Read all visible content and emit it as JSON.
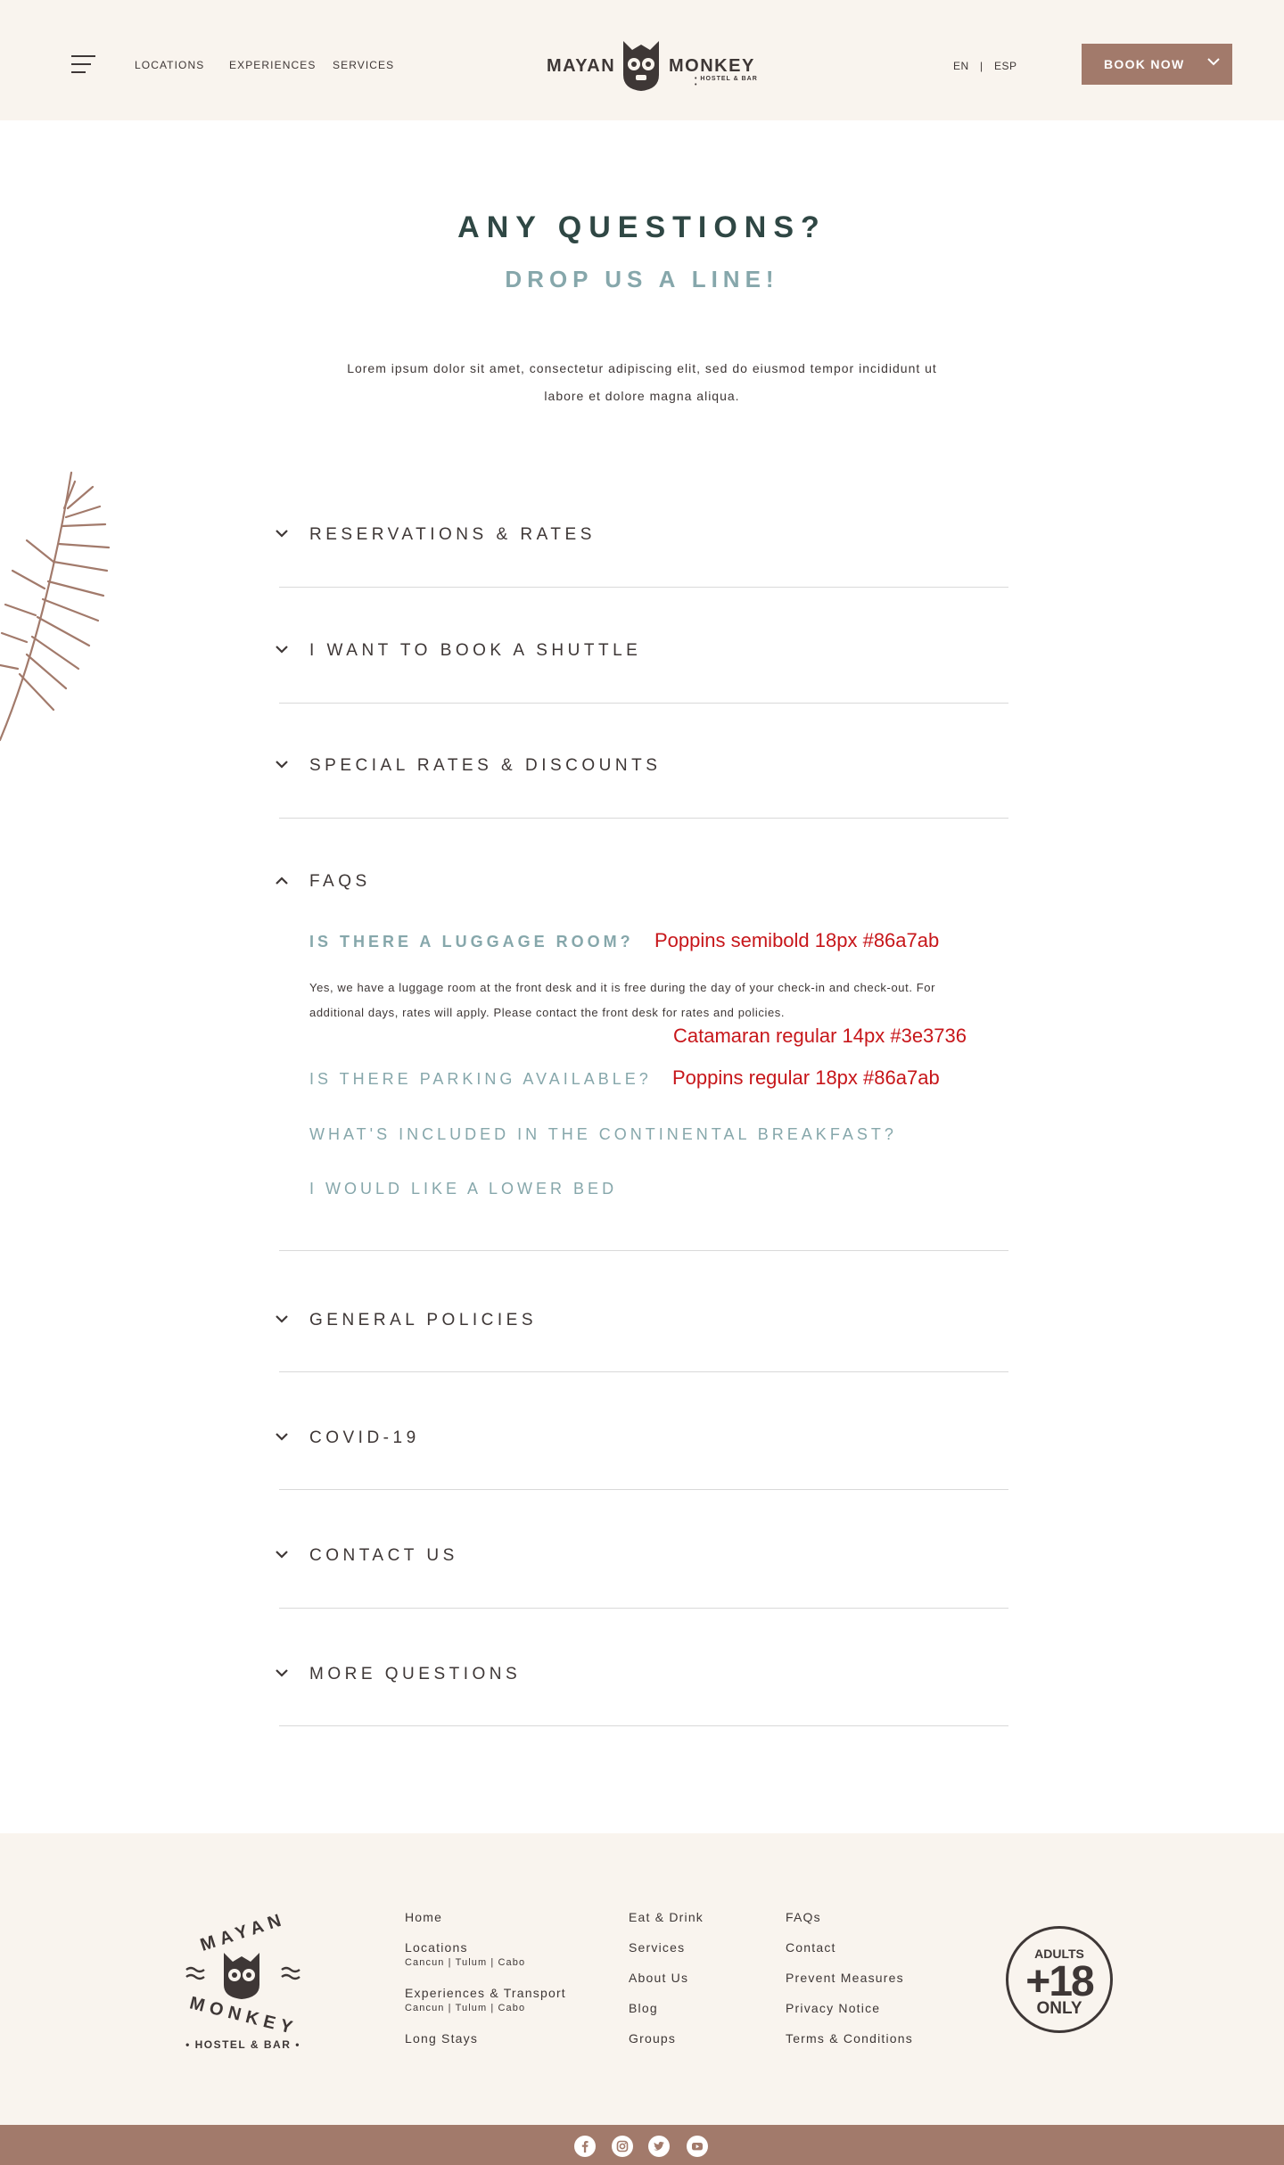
{
  "header": {
    "nav": [
      "LOCATIONS",
      "EXPERIENCES",
      "SERVICES"
    ],
    "logo_left": "MAYAN",
    "logo_right": "MONKEY",
    "logo_sub": "• HOSTEL & BAR •",
    "lang_en": "EN",
    "lang_sep": "|",
    "lang_esp": "ESP",
    "book_label": "BOOK NOW"
  },
  "hero": {
    "title": "ANY QUESTIONS?",
    "subtitle": "DROP US A LINE!",
    "intro": "Lorem ipsum dolor sit amet, consectetur adipiscing elit, sed do eiusmod tempor incididunt ut labore et dolore magna aliqua."
  },
  "accordion": {
    "sections": [
      "RESERVATIONS & RATES",
      "I WANT TO BOOK A SHUTTLE",
      "SPECIAL RATES & DISCOUNTS",
      "FAQS",
      "GENERAL POLICIES",
      "COVID-19",
      "CONTACT US",
      "MORE QUESTIONS"
    ],
    "expanded_section": "FAQS",
    "questions": [
      "IS THERE A LUGGAGE ROOM?",
      "IS THERE PARKING AVAILABLE?",
      "WHAT'S INCLUDED IN THE CONTINENTAL BREAKFAST?",
      "I WOULD LIKE A LOWER BED"
    ],
    "answer": "Yes, we have a luggage room at the front desk and it is free during the day of your check-in and check-out. For additional days, rates will apply. Please contact the front desk for rates and policies."
  },
  "annotations": {
    "q_active": "Poppins semibold 18px #86a7ab",
    "answer": "Catamaran regular 14px #3e3736",
    "q_regular": "Poppins regular 18px #86a7ab"
  },
  "footer": {
    "logo_top": "MAYAN",
    "logo_bottom": "MONKEY",
    "logo_sub": "• HOSTEL & BAR •",
    "col1": {
      "home": "Home",
      "locations": "Locations",
      "locations_sub": "Cancun | Tulum | Cabo",
      "experiences": "Experiences & Transport",
      "experiences_sub": "Cancun | Tulum | Cabo",
      "long_stays": "Long Stays"
    },
    "col2": [
      "Eat & Drink",
      "Services",
      "About Us",
      "Blog",
      "Groups"
    ],
    "col3": [
      "FAQs",
      "Contact",
      "Prevent Measures",
      "Privacy Notice",
      "Terms & Conditions"
    ],
    "badge_top": "ADULTS",
    "badge_big": "+18",
    "badge_bottom": "ONLY"
  },
  "social": [
    "facebook-icon",
    "instagram-icon",
    "twitter-icon",
    "youtube-icon"
  ],
  "colors": {
    "header_bg": "#f9f4ee",
    "accent": "#a27a6b",
    "teal": "#86a7ab",
    "dark": "#3e3736",
    "title": "#2f4744",
    "annotation": "#c7161a"
  }
}
